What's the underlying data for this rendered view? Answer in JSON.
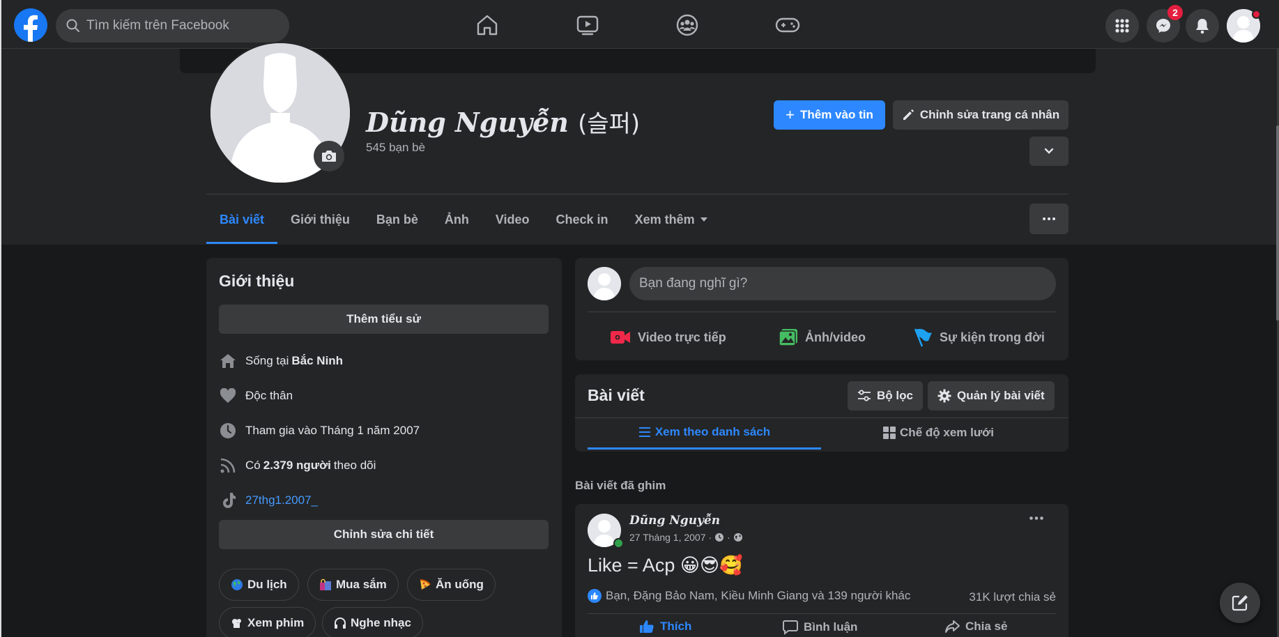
{
  "topbar": {
    "search_placeholder": "Tìm kiếm trên Facebook",
    "nav": [
      "home-icon",
      "watch-icon",
      "groups-icon",
      "gaming-icon"
    ],
    "messenger_badge": "2"
  },
  "profile": {
    "name": "Dũng Nguyễn",
    "name_suffix": "(슬퍼)",
    "friends": "545 bạn bè",
    "add_story": "Thêm vào tin",
    "edit_profile": "Chỉnh sửa trang cá nhân"
  },
  "tabs": [
    "Bài viết",
    "Giới thiệu",
    "Bạn bè",
    "Ảnh",
    "Video",
    "Check in",
    "Xem thêm"
  ],
  "intro": {
    "title": "Giới thiệu",
    "add_bio": "Thêm tiểu sử",
    "lives_prefix": "Sống tại",
    "lives_place": "Bắc Ninh",
    "relationship": "Độc thân",
    "joined": "Tham gia vào Tháng 1 năm 2007",
    "followers_prefix": "Có",
    "followers_count": "2.379 người",
    "followers_suffix": "theo dõi",
    "tiktok": "27thg1.2007_",
    "edit_details": "Chỉnh sửa chi tiết",
    "hobbies": [
      "Du lịch",
      "Mua sắm",
      "Ăn uống",
      "Xem phim",
      "Nghe nhạc"
    ]
  },
  "composer": {
    "placeholder": "Bạn đang nghĩ gì?",
    "live": "Video trực tiếp",
    "photo": "Ảnh/video",
    "life_event": "Sự kiện trong đời"
  },
  "posts_header": {
    "title": "Bài viết",
    "filter": "Bộ lọc",
    "manage": "Quản lý bài viết",
    "list_view": "Xem theo danh sách",
    "grid_view": "Chế độ xem lưới"
  },
  "pinned": {
    "label": "Bài viết đã ghim",
    "author": "Dũng Nguyễn",
    "date": "27 Tháng 1, 2007 ·",
    "text": "Like = Acp 😀😎🥰",
    "reactions": "Bạn, Đặng Bảo Nam, Kiều Minh Giang và 139 người khác",
    "shares": "31K lượt chia sẻ",
    "like": "Thích",
    "comment": "Bình luận",
    "share": "Chia sẻ"
  },
  "colors": {
    "accent": "#2d88ff",
    "background": "#18191a",
    "surface": "#242526",
    "badge": "#e41e3f"
  }
}
